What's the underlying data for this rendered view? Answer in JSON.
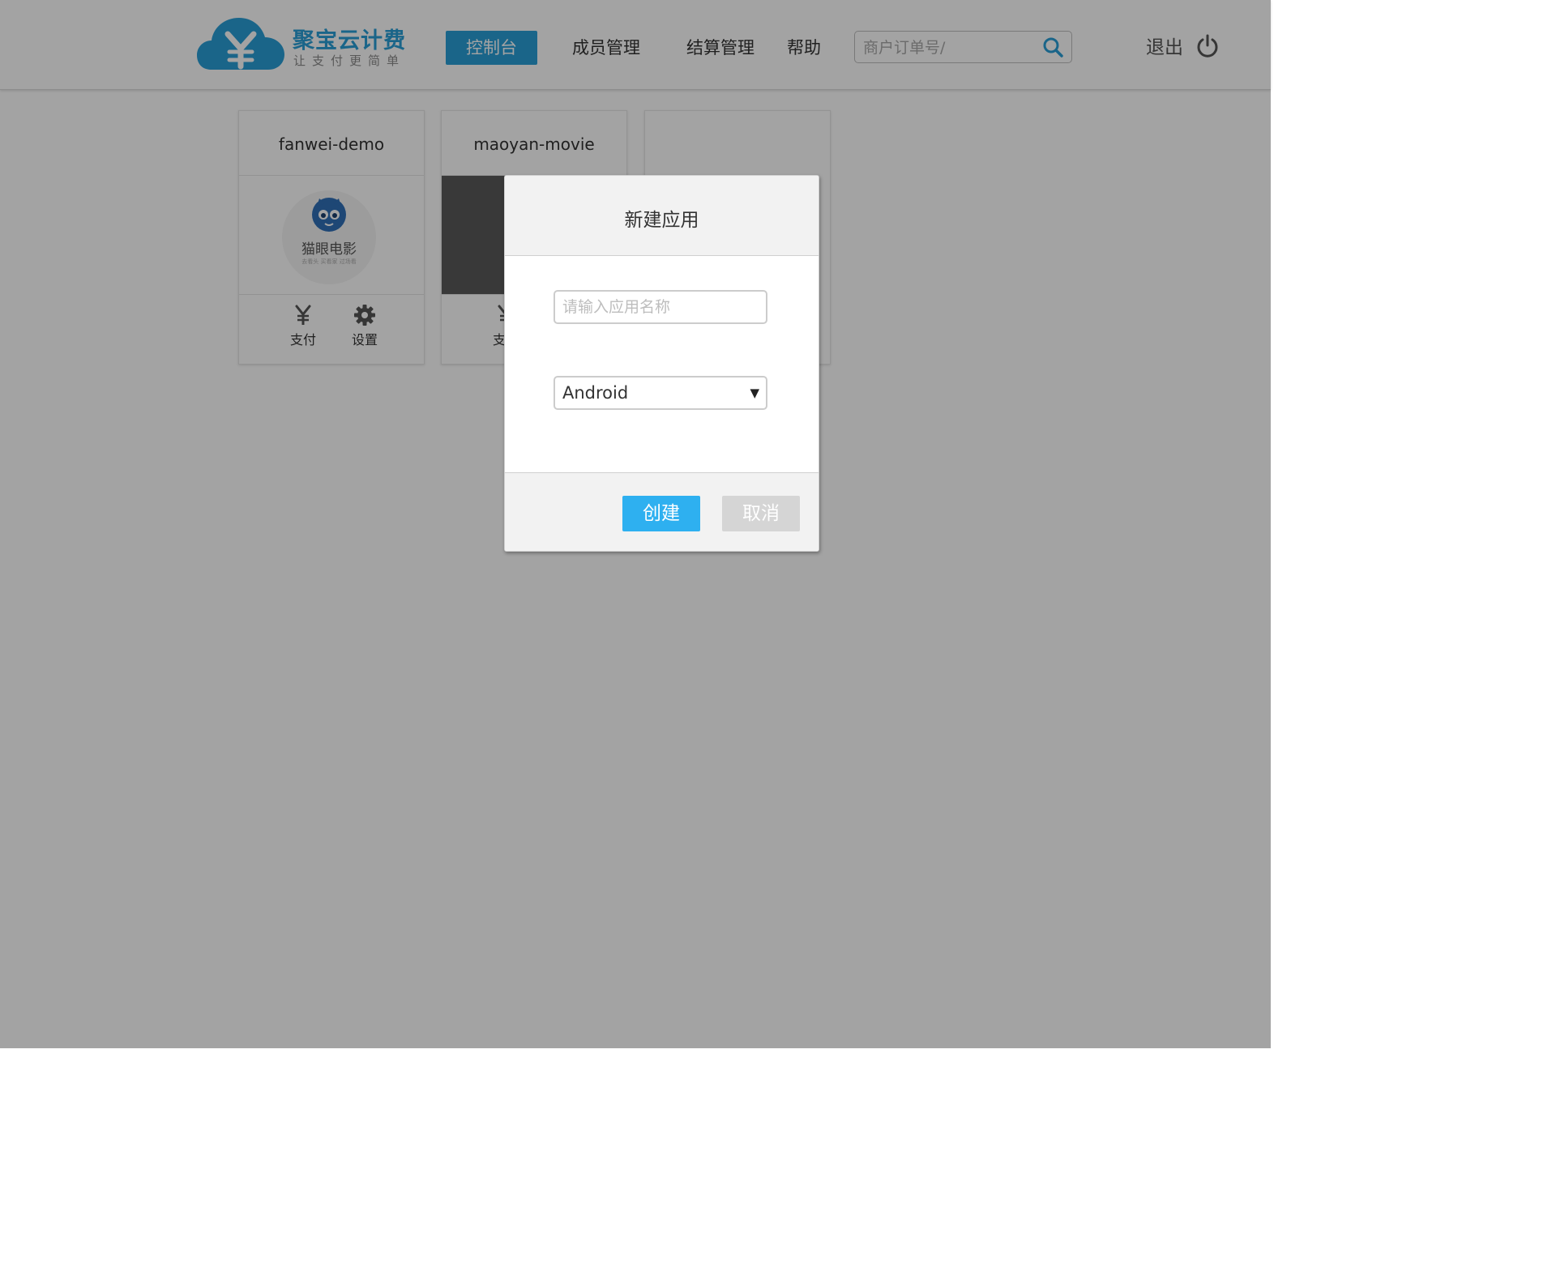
{
  "colors": {
    "brand": "#2a9fd6",
    "primary_button": "#2eb0f0",
    "cancel_button": "#d5d5d5",
    "overlay": "rgba(0,0,0,0.36)"
  },
  "header": {
    "logo": {
      "title": "聚宝云计费",
      "slogan": "让支付更简单",
      "icon": "cloud-yen-icon"
    },
    "nav": [
      {
        "label": "控制台",
        "active": true
      },
      {
        "label": "成员管理",
        "active": false
      },
      {
        "label": "结算管理",
        "active": false
      },
      {
        "label": "帮助",
        "active": false
      }
    ],
    "search": {
      "placeholder": "商户订单号/",
      "value": "",
      "icon": "search-icon"
    },
    "logout": {
      "label": "退出",
      "icon": "power-icon"
    }
  },
  "apps": [
    {
      "name": "fanwei-demo",
      "logo_text": "猫眼电影",
      "logo_sub": "去看头 买看家 过场看",
      "actions": [
        {
          "label": "支付",
          "icon": "yen-icon"
        },
        {
          "label": "设置",
          "icon": "gear-icon"
        }
      ]
    },
    {
      "name": "maoyan-movie",
      "actions": [
        {
          "label": "支付",
          "icon": "yen-icon"
        }
      ]
    },
    {
      "name": ""
    }
  ],
  "modal": {
    "title": "新建应用",
    "name_input": {
      "placeholder": "请输入应用名称",
      "value": ""
    },
    "platform_select": {
      "value": "Android",
      "arrow": "▼"
    },
    "buttons": {
      "create": "创建",
      "cancel": "取消"
    }
  }
}
